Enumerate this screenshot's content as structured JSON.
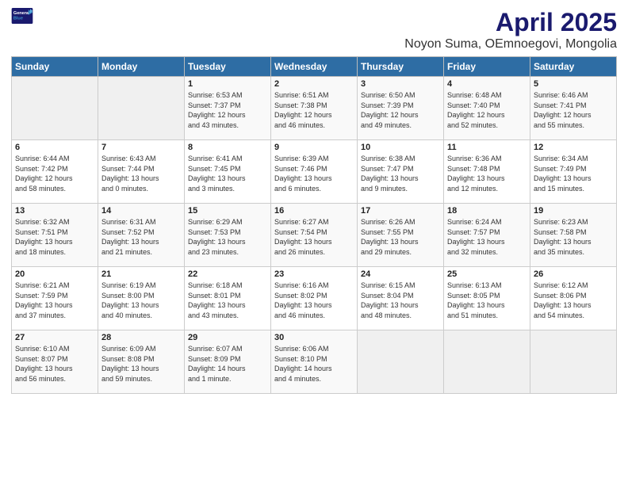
{
  "app": {
    "logo_general": "General",
    "logo_blue": "Blue",
    "title": "April 2025",
    "subtitle": "Noyon Suma, OEmnoegovi, Mongolia"
  },
  "weekdays": [
    "Sunday",
    "Monday",
    "Tuesday",
    "Wednesday",
    "Thursday",
    "Friday",
    "Saturday"
  ],
  "rows": [
    [
      {
        "num": "",
        "info": ""
      },
      {
        "num": "",
        "info": ""
      },
      {
        "num": "1",
        "info": "Sunrise: 6:53 AM\nSunset: 7:37 PM\nDaylight: 12 hours\nand 43 minutes."
      },
      {
        "num": "2",
        "info": "Sunrise: 6:51 AM\nSunset: 7:38 PM\nDaylight: 12 hours\nand 46 minutes."
      },
      {
        "num": "3",
        "info": "Sunrise: 6:50 AM\nSunset: 7:39 PM\nDaylight: 12 hours\nand 49 minutes."
      },
      {
        "num": "4",
        "info": "Sunrise: 6:48 AM\nSunset: 7:40 PM\nDaylight: 12 hours\nand 52 minutes."
      },
      {
        "num": "5",
        "info": "Sunrise: 6:46 AM\nSunset: 7:41 PM\nDaylight: 12 hours\nand 55 minutes."
      }
    ],
    [
      {
        "num": "6",
        "info": "Sunrise: 6:44 AM\nSunset: 7:42 PM\nDaylight: 12 hours\nand 58 minutes."
      },
      {
        "num": "7",
        "info": "Sunrise: 6:43 AM\nSunset: 7:44 PM\nDaylight: 13 hours\nand 0 minutes."
      },
      {
        "num": "8",
        "info": "Sunrise: 6:41 AM\nSunset: 7:45 PM\nDaylight: 13 hours\nand 3 minutes."
      },
      {
        "num": "9",
        "info": "Sunrise: 6:39 AM\nSunset: 7:46 PM\nDaylight: 13 hours\nand 6 minutes."
      },
      {
        "num": "10",
        "info": "Sunrise: 6:38 AM\nSunset: 7:47 PM\nDaylight: 13 hours\nand 9 minutes."
      },
      {
        "num": "11",
        "info": "Sunrise: 6:36 AM\nSunset: 7:48 PM\nDaylight: 13 hours\nand 12 minutes."
      },
      {
        "num": "12",
        "info": "Sunrise: 6:34 AM\nSunset: 7:49 PM\nDaylight: 13 hours\nand 15 minutes."
      }
    ],
    [
      {
        "num": "13",
        "info": "Sunrise: 6:32 AM\nSunset: 7:51 PM\nDaylight: 13 hours\nand 18 minutes."
      },
      {
        "num": "14",
        "info": "Sunrise: 6:31 AM\nSunset: 7:52 PM\nDaylight: 13 hours\nand 21 minutes."
      },
      {
        "num": "15",
        "info": "Sunrise: 6:29 AM\nSunset: 7:53 PM\nDaylight: 13 hours\nand 23 minutes."
      },
      {
        "num": "16",
        "info": "Sunrise: 6:27 AM\nSunset: 7:54 PM\nDaylight: 13 hours\nand 26 minutes."
      },
      {
        "num": "17",
        "info": "Sunrise: 6:26 AM\nSunset: 7:55 PM\nDaylight: 13 hours\nand 29 minutes."
      },
      {
        "num": "18",
        "info": "Sunrise: 6:24 AM\nSunset: 7:57 PM\nDaylight: 13 hours\nand 32 minutes."
      },
      {
        "num": "19",
        "info": "Sunrise: 6:23 AM\nSunset: 7:58 PM\nDaylight: 13 hours\nand 35 minutes."
      }
    ],
    [
      {
        "num": "20",
        "info": "Sunrise: 6:21 AM\nSunset: 7:59 PM\nDaylight: 13 hours\nand 37 minutes."
      },
      {
        "num": "21",
        "info": "Sunrise: 6:19 AM\nSunset: 8:00 PM\nDaylight: 13 hours\nand 40 minutes."
      },
      {
        "num": "22",
        "info": "Sunrise: 6:18 AM\nSunset: 8:01 PM\nDaylight: 13 hours\nand 43 minutes."
      },
      {
        "num": "23",
        "info": "Sunrise: 6:16 AM\nSunset: 8:02 PM\nDaylight: 13 hours\nand 46 minutes."
      },
      {
        "num": "24",
        "info": "Sunrise: 6:15 AM\nSunset: 8:04 PM\nDaylight: 13 hours\nand 48 minutes."
      },
      {
        "num": "25",
        "info": "Sunrise: 6:13 AM\nSunset: 8:05 PM\nDaylight: 13 hours\nand 51 minutes."
      },
      {
        "num": "26",
        "info": "Sunrise: 6:12 AM\nSunset: 8:06 PM\nDaylight: 13 hours\nand 54 minutes."
      }
    ],
    [
      {
        "num": "27",
        "info": "Sunrise: 6:10 AM\nSunset: 8:07 PM\nDaylight: 13 hours\nand 56 minutes."
      },
      {
        "num": "28",
        "info": "Sunrise: 6:09 AM\nSunset: 8:08 PM\nDaylight: 13 hours\nand 59 minutes."
      },
      {
        "num": "29",
        "info": "Sunrise: 6:07 AM\nSunset: 8:09 PM\nDaylight: 14 hours\nand 1 minute."
      },
      {
        "num": "30",
        "info": "Sunrise: 6:06 AM\nSunset: 8:10 PM\nDaylight: 14 hours\nand 4 minutes."
      },
      {
        "num": "",
        "info": ""
      },
      {
        "num": "",
        "info": ""
      },
      {
        "num": "",
        "info": ""
      }
    ]
  ]
}
